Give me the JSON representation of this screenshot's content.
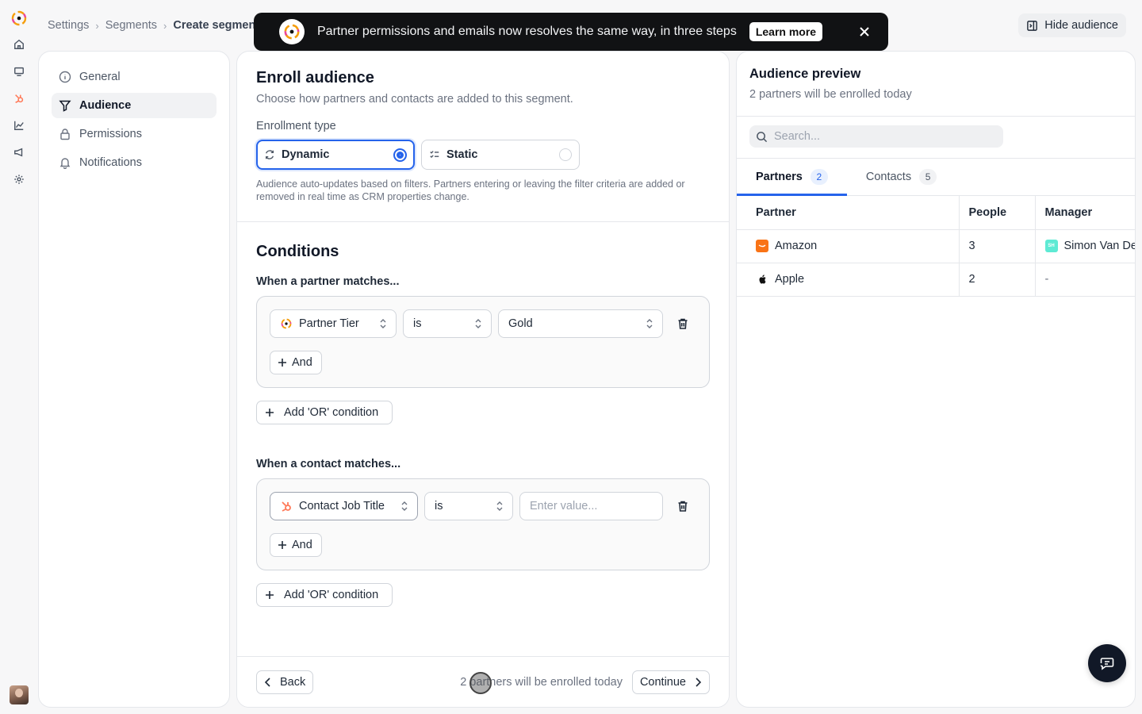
{
  "breadcrumb": {
    "items": [
      "Settings",
      "Segments"
    ],
    "current": "Create segmen"
  },
  "header": {
    "hide_audience_label": "Hide audience"
  },
  "banner": {
    "text": "Partner permissions and emails now resolves the same way, in three steps",
    "learn_more": "Learn more"
  },
  "sidebar": {
    "items": [
      {
        "label": "General",
        "icon": "info-icon"
      },
      {
        "label": "Audience",
        "icon": "filter-icon",
        "active": true
      },
      {
        "label": "Permissions",
        "icon": "lock-icon"
      },
      {
        "label": "Notifications",
        "icon": "bell-icon"
      }
    ]
  },
  "enroll": {
    "title": "Enroll audience",
    "subtitle": "Choose how partners and contacts are added to this segment.",
    "type_label": "Enrollment type",
    "dynamic_label": "Dynamic",
    "static_label": "Static",
    "selected": "Dynamic",
    "help": "Audience auto-updates based on filters. Partners entering or leaving the filter criteria are added or removed in real time as CRM properties change."
  },
  "conditions": {
    "title": "Conditions",
    "partner": {
      "heading": "When a partner matches...",
      "property": "Partner Tier",
      "operator": "is",
      "value": "Gold",
      "and_label": "And",
      "or_label": "Add 'OR' condition"
    },
    "contact": {
      "heading": "When a contact matches...",
      "property": "Contact Job Title",
      "operator": "is",
      "value_placeholder": "Enter value...",
      "and_label": "And",
      "or_label": "Add 'OR' condition"
    }
  },
  "footer": {
    "back_label": "Back",
    "note": "2 partners will be enrolled today",
    "continue_label": "Continue"
  },
  "preview": {
    "title": "Audience preview",
    "subtitle": "2 partners will be enrolled today",
    "search_placeholder": "Search...",
    "tabs": [
      {
        "label": "Partners",
        "count": "2",
        "active": true
      },
      {
        "label": "Contacts",
        "count": "5"
      }
    ],
    "columns": [
      "Partner",
      "People",
      "Manager"
    ],
    "rows": [
      {
        "partner": "Amazon",
        "people": "3",
        "manager_initials": "SH",
        "manager": "Simon Van De"
      },
      {
        "partner": "Apple",
        "people": "2",
        "manager": "-"
      }
    ]
  },
  "colors": {
    "accent": "#2563eb",
    "banner_bg": "#111214",
    "hubspot_orange": "#ff7a59",
    "amazon": "#f97316"
  }
}
